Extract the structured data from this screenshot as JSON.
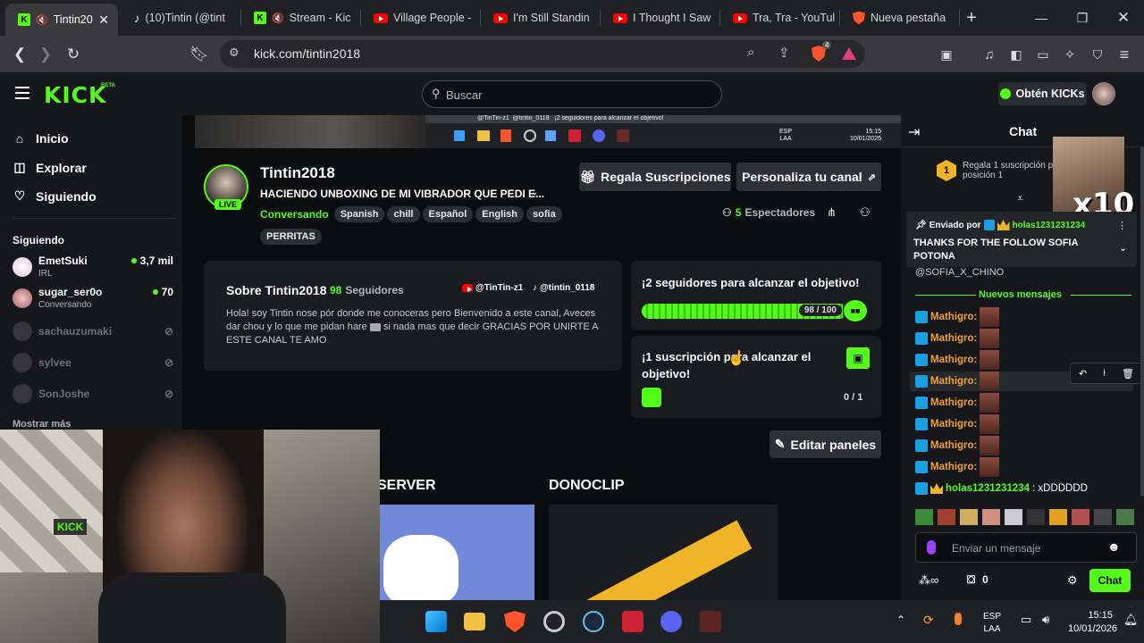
{
  "browser": {
    "tabs": [
      {
        "label": "Tintin20",
        "favicon": "kick-icon",
        "muted": true,
        "active": true
      },
      {
        "label": "(10)Tintin (@tint",
        "favicon": "tiktok-icon"
      },
      {
        "label": "Stream - Kic",
        "favicon": "kick-icon",
        "muted": true
      },
      {
        "label": "Village People -",
        "favicon": "youtube-icon"
      },
      {
        "label": "I'm Still Standin",
        "favicon": "youtube-icon"
      },
      {
        "label": "I Thought I Saw",
        "favicon": "youtube-icon"
      },
      {
        "label": "Tra, Tra - YouTul",
        "favicon": "youtube-icon"
      },
      {
        "label": "Nueva pestaña",
        "favicon": "brave-icon"
      }
    ],
    "url": "kick.com/tintin2018",
    "shield_count": "4"
  },
  "header": {
    "logo": "KICK",
    "logo_beta": "BETA",
    "search_placeholder": "Buscar",
    "obtain_button": "Obtén KICKs"
  },
  "sidebar": {
    "nav": [
      {
        "label": "Inicio",
        "icon": "home-icon"
      },
      {
        "label": "Explorar",
        "icon": "compass-icon"
      },
      {
        "label": "Siguiendo",
        "icon": "heart-icon"
      }
    ],
    "following_title": "Siguiendo",
    "channels": [
      {
        "name": "EmetSuki",
        "sub": "IRL",
        "viewers": "3,7 mil",
        "live": true
      },
      {
        "name": "sugar_ser0o",
        "sub": "Conversando",
        "viewers": "70",
        "live": true
      },
      {
        "name": "sachauzumaki",
        "live": false
      },
      {
        "name": "sylvee",
        "live": false
      },
      {
        "name": "SonJoshe",
        "live": false
      }
    ],
    "show_more": "Mostrar más"
  },
  "stream_preview": {
    "overlay_left": "@TinTin-z1",
    "overlay_mid": "@tintin_0118",
    "overlay_goal": "¡2 seguidores para alcanzar el objetivo!",
    "lang": "ESP",
    "lang_sub": "LAA",
    "time": "15:15",
    "date": "10/01/2026"
  },
  "channel": {
    "name": "Tintin2018",
    "live_badge": "LIVE",
    "title": "HACIENDO UNBOXING DE MI VIBRADOR QUE PEDI E...",
    "category": "Conversando",
    "tags": [
      "Spanish",
      "chill",
      "Español",
      "English",
      "sofia",
      "PERRITAS"
    ],
    "viewers_count": "5",
    "viewers_label": "Espectadores",
    "gift_subs_button": "Regala Suscripciones",
    "customize_button": "Personaliza tu canal"
  },
  "about": {
    "title": "Sobre Tintin2018",
    "followers_count": "98",
    "followers_label": "Seguidores",
    "social_youtube": "@TinTin-z1",
    "social_tiktok": "@tintin_0118",
    "bio_before": "Hola! soy Tintin nose pór donde me conoceras pero Bienvenido a este canal, Aveces dar chou y lo que me pidan hare",
    "bio_after": " si nada mas que decir GRACIAS POR UNIRTE A ESTE CANAL TE AMO"
  },
  "goals": {
    "followers_goal_text": "¡2 seguidores para alcanzar el objetivo!",
    "followers_progress": "98 / 100",
    "followers_fraction": 0.98,
    "sub_goal_text": "¡1 suscripción para alcanzar el objetivo!",
    "sub_progress": "0 / 1"
  },
  "panels": {
    "edit_button": "Editar paneles",
    "server_label": "SERVER",
    "donoclip_label": "DONOCLIP"
  },
  "chat": {
    "title": "Chat",
    "pinned_gift": "Regala 1 suscripción p",
    "pinned_gift_2": "posición 1",
    "pinned_rank": "1",
    "x10": "x10",
    "sent_by_label": "Enviado por",
    "sent_by_user": "holas1231231234",
    "pinned_message": "THANKS FOR THE FOLLOW SOFIA POTONA",
    "mention_line": "@SOFIA_X_CHINO",
    "new_messages": "Nuevos mensajes",
    "messages": [
      {
        "user": "Mathigro:"
      },
      {
        "user": "Mathigro:"
      },
      {
        "user": "Mathigro:"
      },
      {
        "user": "Mathigro:"
      },
      {
        "user": "Mathigro:"
      },
      {
        "user": "Mathigro:"
      },
      {
        "user": "Mathigro:"
      },
      {
        "user": "Mathigro:"
      }
    ],
    "last_user": "holas1231231234",
    "last_text": ": xDDDDDD",
    "input_placeholder": "Enviar un mensaje",
    "points": "0",
    "send_button": "Chat",
    "colors": {
      "accent": "#53fc18",
      "mathigro": "#f0a030",
      "holas": "#53fc18"
    }
  },
  "taskbar": {
    "lang": "ESP",
    "lang_sub": "LAA",
    "time": "15:15",
    "date": "10/01/2026"
  },
  "webcam": {
    "sign": "KICK"
  }
}
